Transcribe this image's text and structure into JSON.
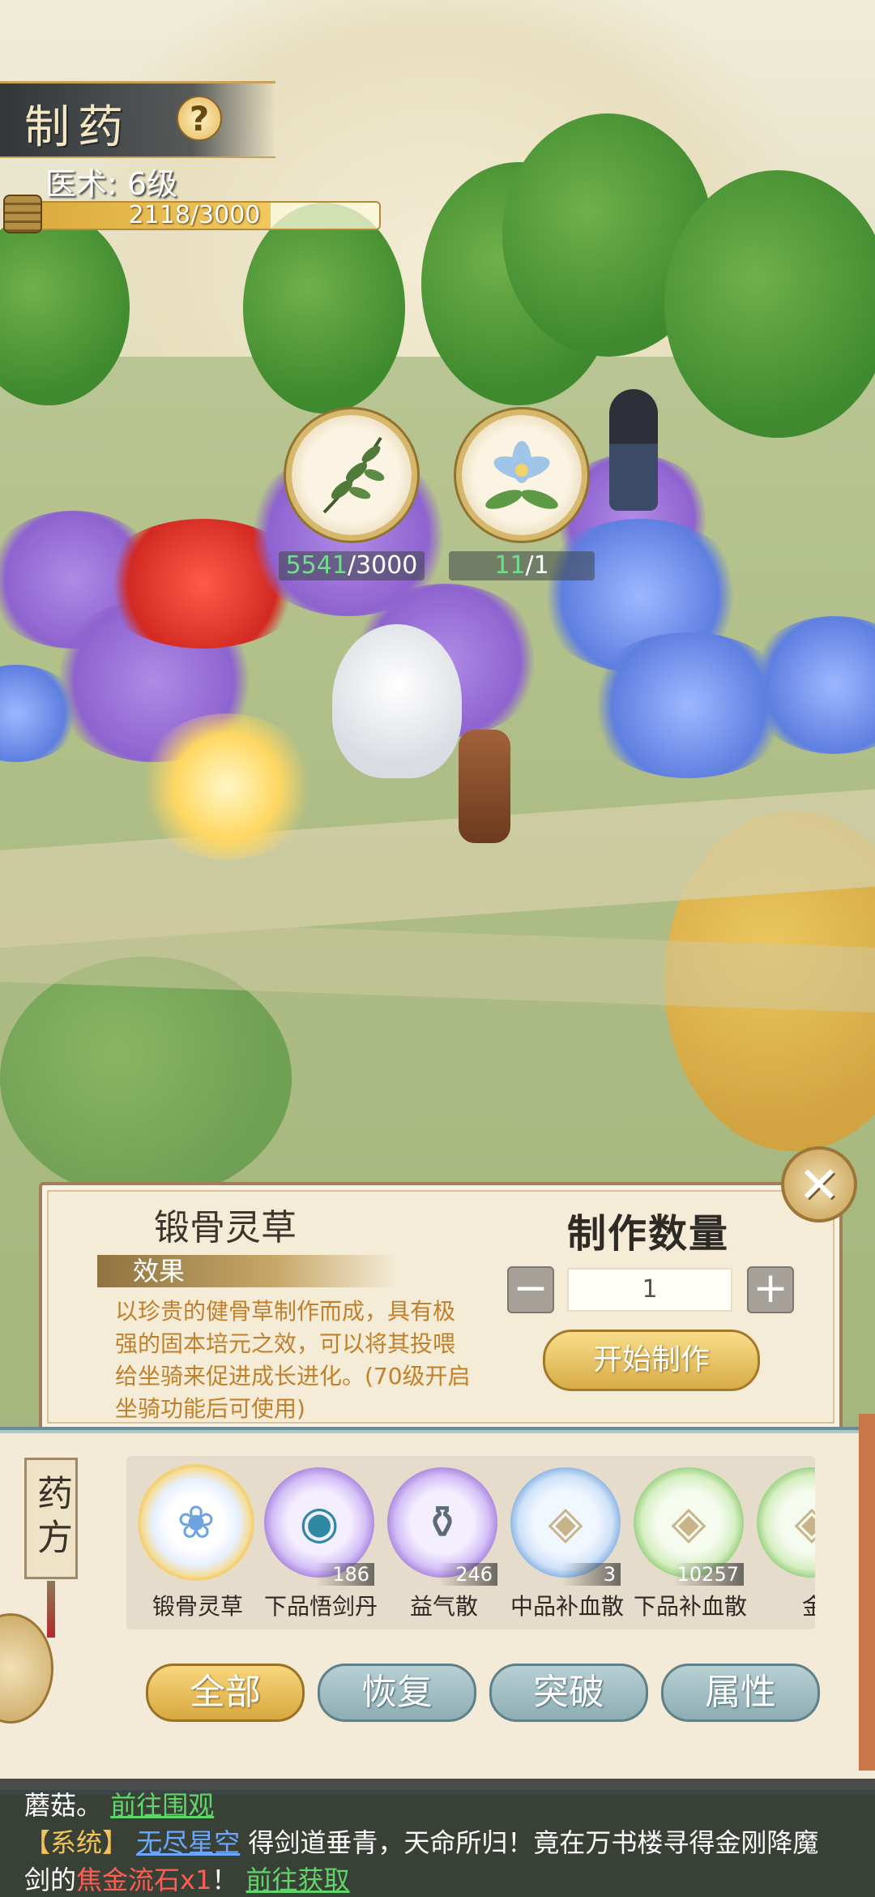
{
  "hud": {
    "title": "制药",
    "help": "?",
    "skill_label": "医术: 6级",
    "xp_text": "2118/3000",
    "xp_fraction": 0.706
  },
  "ingredients": [
    {
      "icon": "herb-leaf-icon",
      "have": "5541",
      "need": "/3000"
    },
    {
      "icon": "blue-flower-icon",
      "have": "11",
      "need": "/1"
    }
  ],
  "recipe": {
    "name": "锻骨灵草",
    "effect_label": "效果",
    "effect_text": "以珍贵的健骨草制作而成，具有极强的固本培元之效，可以将其投喂给坐骑来促进成长进化。(70级开启坐骑功能后可使用)",
    "qty_title": "制作数量",
    "minus": "−",
    "plus": "+",
    "qty_value": "1",
    "start_label": "开始制作",
    "close": "✕"
  },
  "list": {
    "side_tag": "药方",
    "items": [
      {
        "name": "锻骨灵草",
        "count": "",
        "style": "gold",
        "glyph": "❀"
      },
      {
        "name": "下品悟剑丹",
        "count": "186",
        "style": "purple",
        "glyph": "◉"
      },
      {
        "name": "益气散",
        "count": "246",
        "style": "purple",
        "glyph": "⚱"
      },
      {
        "name": "中品补血散",
        "count": "3",
        "style": "blue",
        "glyph": "◈"
      },
      {
        "name": "下品补血散",
        "count": "10257",
        "style": "green",
        "glyph": "◈"
      },
      {
        "name": "金",
        "count": "",
        "style": "green",
        "glyph": "◈"
      }
    ],
    "filters": [
      "全部",
      "恢复",
      "突破",
      "属性"
    ]
  },
  "chat": {
    "line1_text": "蘑菇。",
    "line1_link": "前往围观",
    "line2_tag": "【系统】",
    "line2_player": "无尽星空",
    "line2_text": "得剑道垂青，天命所归！竟在万书楼寻得金刚降魔",
    "line3_prefix": "剑的",
    "line3_item": "焦金流石x1",
    "line3_excl": "！",
    "line3_link": "前往获取"
  }
}
